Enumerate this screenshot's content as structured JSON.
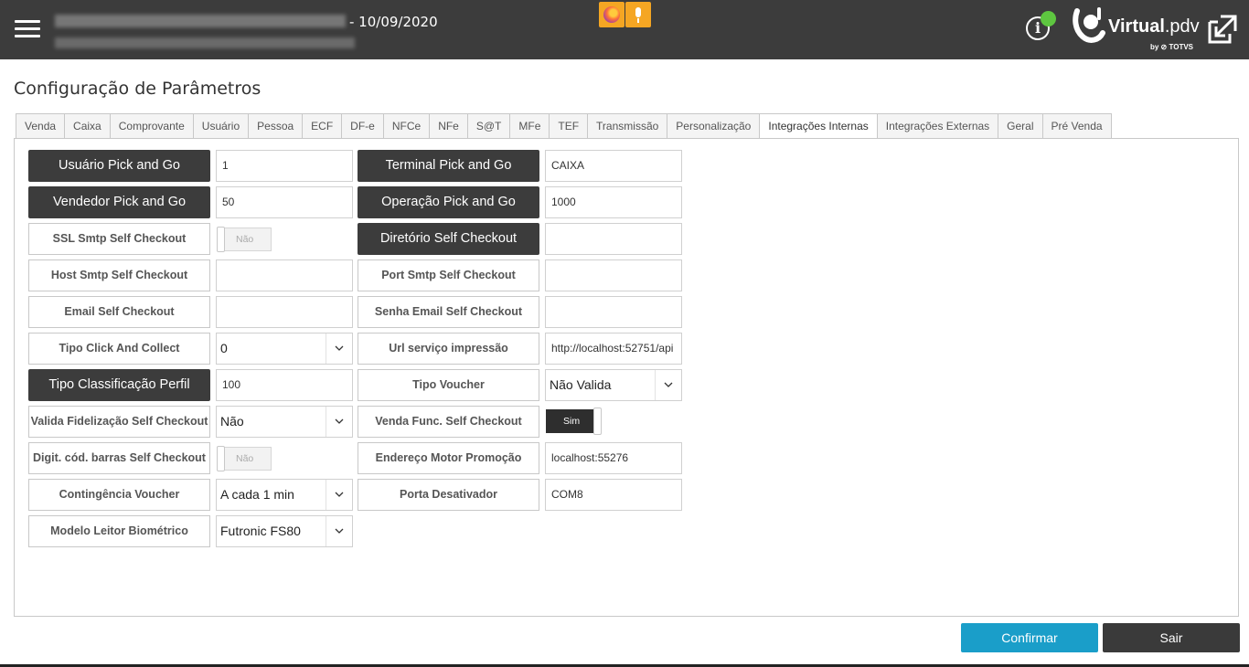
{
  "header": {
    "date_text": "- 10/09/2020",
    "logo_text_bold": "Virtual",
    "logo_text_light": ".pdv",
    "logo_by": "by ⊘ TOTVS",
    "info_glyph": "i",
    "icons": [
      "menu-icon",
      "firefox-icon",
      "microphone-icon",
      "info-icon",
      "status-online-icon",
      "virtual-pdv-logo",
      "expand-window-icon"
    ],
    "status_color": "#5ec640"
  },
  "page": {
    "title": "Configuração de Parâmetros"
  },
  "tabs": [
    {
      "label": "Venda"
    },
    {
      "label": "Caixa"
    },
    {
      "label": "Comprovante"
    },
    {
      "label": "Usuário"
    },
    {
      "label": "Pessoa"
    },
    {
      "label": "ECF"
    },
    {
      "label": "DF-e"
    },
    {
      "label": "NFCe"
    },
    {
      "label": "NFe"
    },
    {
      "label": "S@T"
    },
    {
      "label": "MFe"
    },
    {
      "label": "TEF"
    },
    {
      "label": "Transmissão"
    },
    {
      "label": "Personalização"
    },
    {
      "label": "Integrações Internas"
    },
    {
      "label": "Integrações Externas"
    },
    {
      "label": "Geral"
    },
    {
      "label": "Pré Venda"
    }
  ],
  "active_tab": "Integrações Internas",
  "fields_left": [
    {
      "label": "Usuário Pick and Go",
      "value": "1"
    },
    {
      "label": "Vendedor Pick and Go",
      "value": "50"
    },
    {
      "label": "SSL Smtp Self Checkout",
      "value": "Não"
    },
    {
      "label": "Host Smtp Self Checkout",
      "value": ""
    },
    {
      "label": "Email Self Checkout",
      "value": ""
    },
    {
      "label": "Tipo Click And Collect",
      "value": "0"
    },
    {
      "label": "Tipo Classificação Perfil",
      "value": "100"
    },
    {
      "label": "Valida Fidelização Self Checkout",
      "value": "Não"
    },
    {
      "label": "Digit. cód. barras Self Checkout",
      "value": "Não"
    },
    {
      "label": "Contingência Voucher",
      "value": "A cada 1 min"
    },
    {
      "label": "Modelo Leitor Biométrico",
      "value": "Futronic FS80"
    }
  ],
  "fields_right": [
    {
      "label": "Terminal Pick and Go",
      "value": "CAIXA"
    },
    {
      "label": "Operação Pick and Go",
      "value": "1000"
    },
    {
      "label": "Diretório Self Checkout",
      "value": ""
    },
    {
      "label": "Port Smtp Self Checkout",
      "value": ""
    },
    {
      "label": "Senha Email Self Checkout",
      "value": ""
    },
    {
      "label": "Url serviço impressão",
      "value": "http://localhost:52751/api"
    },
    {
      "label": "Tipo Voucher",
      "value": "Não Valida"
    },
    {
      "label": "Venda Func. Self Checkout",
      "value": "Sim"
    },
    {
      "label": "Endereço Motor Promoção",
      "value": "localhost:55276"
    },
    {
      "label": "Porta Desativador",
      "value": "COM8"
    }
  ],
  "buttons": {
    "confirm": "Confirmar",
    "exit": "Sair"
  },
  "colors": {
    "topbar": "#3c3c3c",
    "dark_label": "#3c3c3c",
    "confirm": "#1a9ec9",
    "exit": "#3a3a3a",
    "badge_bg": "#f5a623"
  }
}
